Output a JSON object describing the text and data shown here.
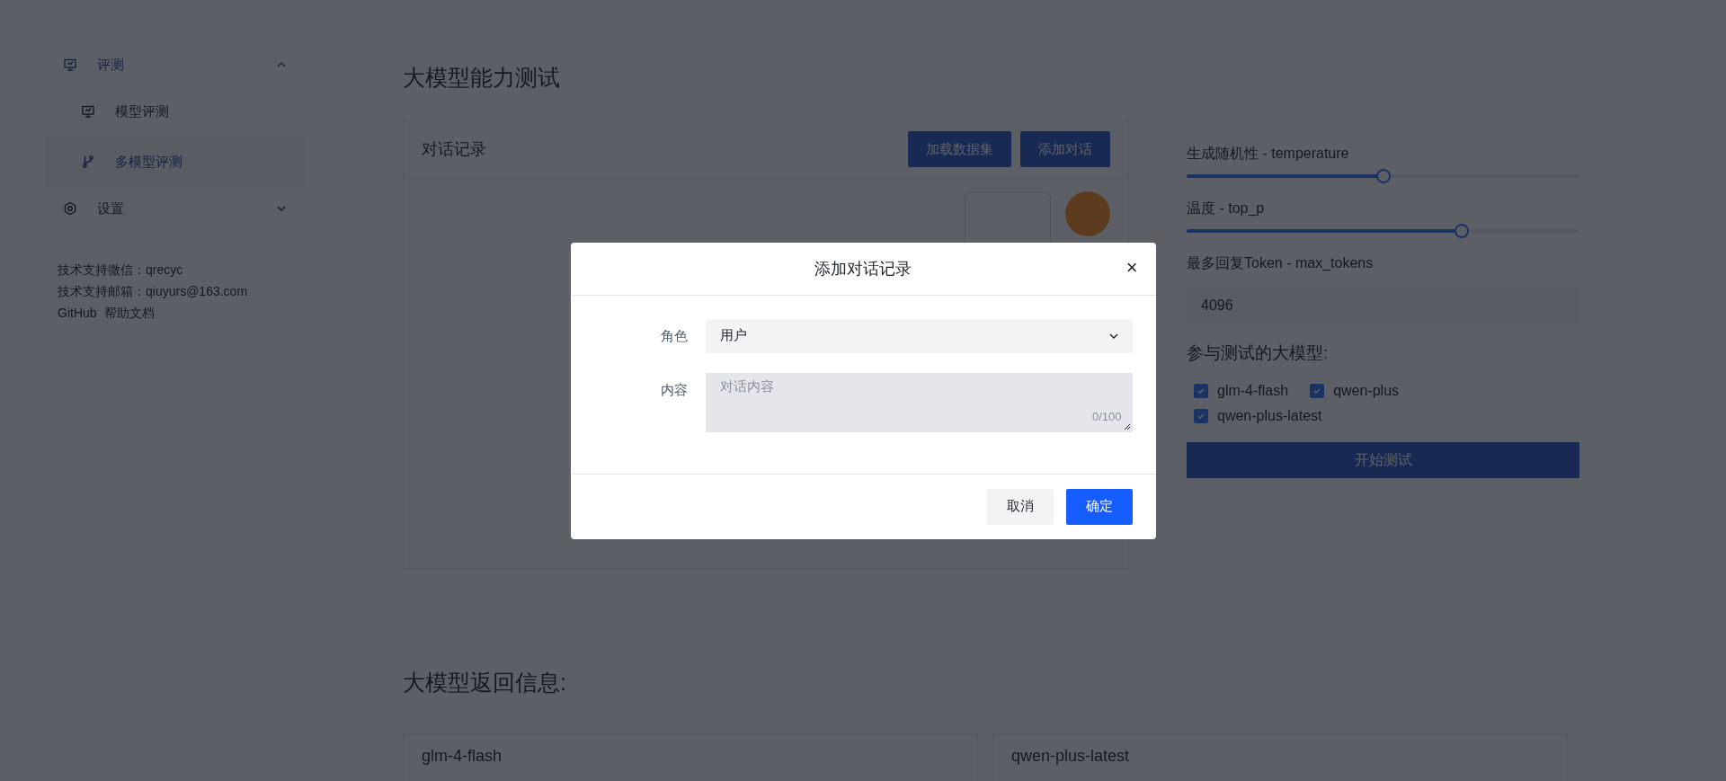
{
  "sidebar": {
    "menu": [
      {
        "label": "评测",
        "expanded": true,
        "children": [
          {
            "label": "模型评测",
            "selected": false
          },
          {
            "label": "多模型评测",
            "selected": true
          }
        ]
      },
      {
        "label": "设置",
        "expanded": false
      }
    ],
    "footer": {
      "lines": [
        "技术支持微信：qrecyc",
        "技术支持邮箱：qiuyurs@163.com"
      ],
      "links": [
        "GitHub",
        "帮助文档"
      ]
    }
  },
  "main": {
    "title": "大模型能力测试",
    "dialog_card": {
      "title": "对话记录",
      "buttons": [
        "加载数据集",
        "添加对话"
      ]
    },
    "params": {
      "sliders": [
        {
          "label": "生成随机性 - temperature",
          "level": 0.5
        },
        {
          "label": "温度 - top_p",
          "level": 0.7
        }
      ],
      "max_tokens": {
        "label": "最多回复Token - max_tokens",
        "value": "4096"
      },
      "models": {
        "label": "参与测试的大模型:",
        "items": [
          {
            "label": "glm-4-flash",
            "checked": true
          },
          {
            "label": "qwen-plus",
            "checked": true
          },
          {
            "label": "qwen-plus-latest",
            "checked": true
          }
        ]
      },
      "start_button": "开始测试"
    },
    "results": {
      "title": "大模型返回信息:",
      "cards": [
        {
          "title": "glm-4-flash"
        },
        {
          "title": "qwen-plus-latest"
        }
      ]
    }
  },
  "modal": {
    "title": "添加对话记录",
    "close": "×",
    "fields": [
      {
        "kind": "select",
        "label": "角色",
        "value": "用户"
      },
      {
        "kind": "textarea",
        "label": "内容",
        "placeholder": "对话内容",
        "counter": "0/100"
      }
    ],
    "buttons": [
      {
        "kind": "secondary",
        "label": "取消"
      },
      {
        "kind": "primary",
        "label": "确定"
      }
    ]
  }
}
